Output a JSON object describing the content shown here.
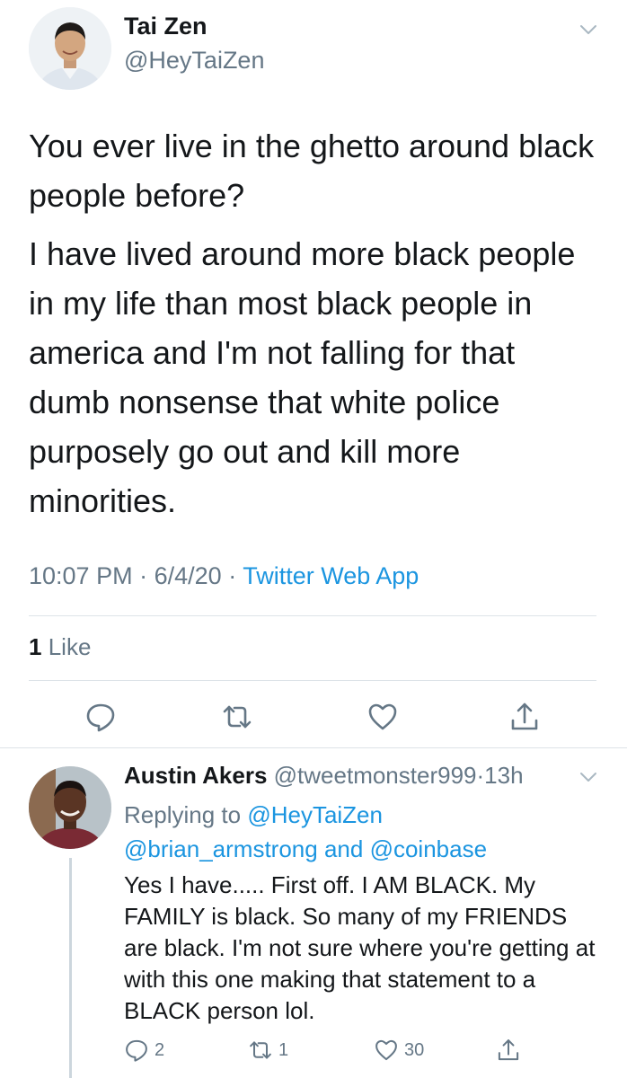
{
  "tweet": {
    "author_name": "Tai Zen",
    "author_handle": "@HeyTaiZen",
    "text_paragraphs": [
      "You ever live in the ghetto around black people before?",
      "I have lived around more black people in my life than most black people in america and I'm not falling for that dumb nonsense that white police purposely go out and kill more minorities."
    ],
    "time": "10:07 PM",
    "date": "6/4/20",
    "source": "Twitter Web App",
    "like_count": "1",
    "like_label": "Like"
  },
  "reply": {
    "author_name": "Austin Akers",
    "author_handle": "@tweetmonster999",
    "age": "13h",
    "replying_to_label": "Replying to",
    "reply_mentions": [
      "@HeyTaiZen",
      "@brian_armstrong",
      "@coinbase"
    ],
    "and_label": "and",
    "text": "Yes I have..... First off. I AM BLACK. My FAMILY is black. So many of my FRIENDS are black. I'm not sure where you're getting at with this one making that statement to a BLACK person lol.",
    "reply_count": "2",
    "retweet_count": "1",
    "like_count": "30"
  },
  "colors": {
    "link_blue": "#1b95e0",
    "secondary_gray": "#657786",
    "divider": "#dde3e8"
  }
}
